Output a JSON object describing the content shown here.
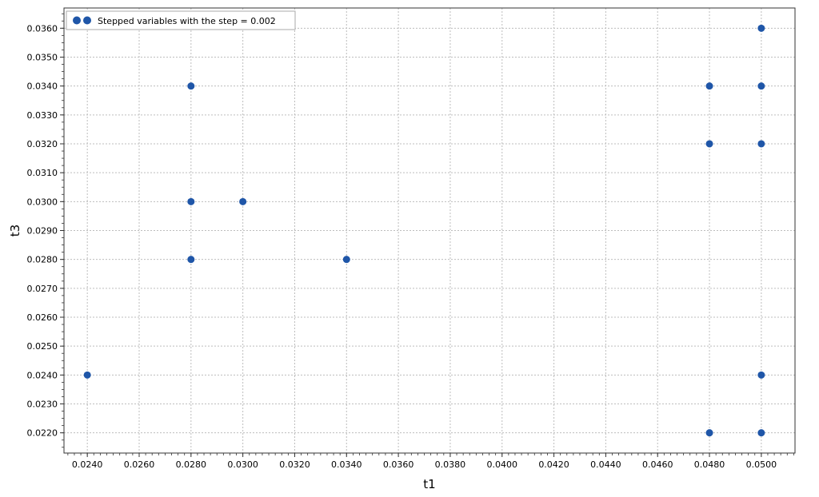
{
  "chart_data": {
    "type": "scatter",
    "title": "",
    "xlabel": "t1",
    "ylabel": "t3",
    "xlim": [
      0.0231,
      0.0513
    ],
    "ylim": [
      0.0213,
      0.0367
    ],
    "grid": true,
    "legend_position": "top-left",
    "x_ticks": [
      "0.0240",
      "0.0260",
      "0.0280",
      "0.0300",
      "0.0320",
      "0.0340",
      "0.0360",
      "0.0380",
      "0.0400",
      "0.0420",
      "0.0440",
      "0.0460",
      "0.0480",
      "0.0500"
    ],
    "y_ticks": [
      "0.0220",
      "0.0230",
      "0.0240",
      "0.0250",
      "0.0260",
      "0.0270",
      "0.0280",
      "0.0290",
      "0.0300",
      "0.0310",
      "0.0320",
      "0.0330",
      "0.0340",
      "0.0350",
      "0.0360"
    ],
    "series": [
      {
        "name": "Stepped variables with the step = 0.002",
        "color": "#1f56a8",
        "points": [
          {
            "x": 0.024,
            "y": 0.024
          },
          {
            "x": 0.028,
            "y": 0.034
          },
          {
            "x": 0.028,
            "y": 0.03
          },
          {
            "x": 0.028,
            "y": 0.028
          },
          {
            "x": 0.03,
            "y": 0.03
          },
          {
            "x": 0.034,
            "y": 0.028
          },
          {
            "x": 0.048,
            "y": 0.034
          },
          {
            "x": 0.048,
            "y": 0.032
          },
          {
            "x": 0.048,
            "y": 0.022
          },
          {
            "x": 0.05,
            "y": 0.036
          },
          {
            "x": 0.05,
            "y": 0.034
          },
          {
            "x": 0.05,
            "y": 0.032
          },
          {
            "x": 0.05,
            "y": 0.024
          },
          {
            "x": 0.05,
            "y": 0.022
          }
        ]
      }
    ]
  }
}
